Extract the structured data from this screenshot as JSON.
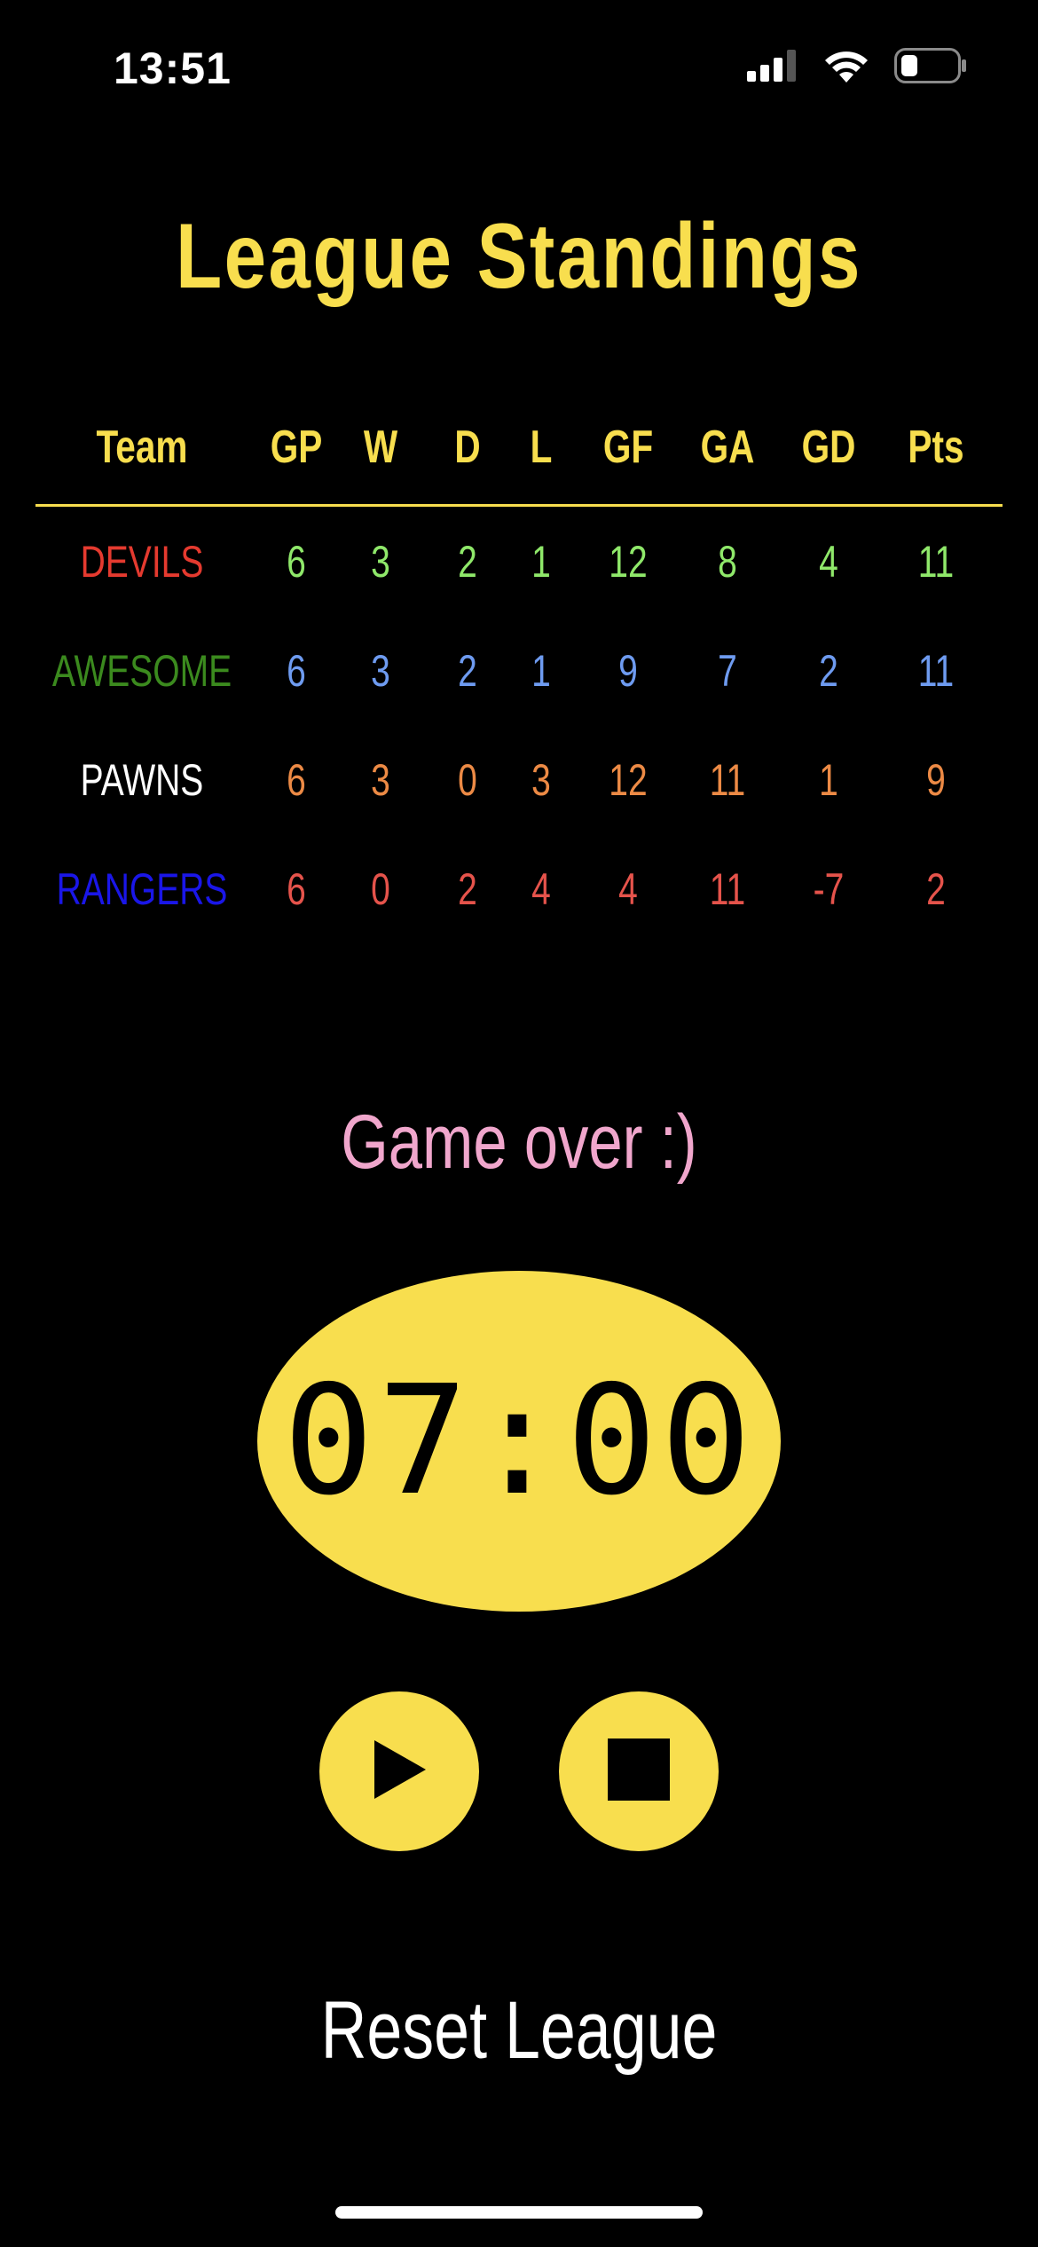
{
  "status_bar": {
    "time": "13:51",
    "icons": [
      "cellular-signal-icon",
      "wifi-icon",
      "battery-icon"
    ]
  },
  "title": "League Standings",
  "standings": {
    "headers": [
      "Team",
      "GP",
      "W",
      "D",
      "L",
      "GF",
      "GA",
      "GD",
      "Pts"
    ],
    "header_color": "#f8de4e",
    "rows": [
      {
        "team": "DEVILS",
        "team_color": "#e53a2f",
        "stat_color": "#8fe86a",
        "gp": "6",
        "w": "3",
        "d": "2",
        "l": "1",
        "gf": "12",
        "ga": "8",
        "gd": "4",
        "pts": "11"
      },
      {
        "team": "AWESOME",
        "team_color": "#3b8a1e",
        "stat_color": "#6e9bf0",
        "gp": "6",
        "w": "3",
        "d": "2",
        "l": "1",
        "gf": "9",
        "ga": "7",
        "gd": "2",
        "pts": "11"
      },
      {
        "team": "PAWNS",
        "team_color": "#ffffff",
        "stat_color": "#ec8a45",
        "gp": "6",
        "w": "3",
        "d": "0",
        "l": "3",
        "gf": "12",
        "ga": "11",
        "gd": "1",
        "pts": "9"
      },
      {
        "team": "RANGERS",
        "team_color": "#1a16e8",
        "stat_color": "#e5534b",
        "gp": "6",
        "w": "0",
        "d": "2",
        "l": "4",
        "gf": "4",
        "ga": "11",
        "gd": "-7",
        "pts": "2"
      }
    ]
  },
  "game_status": "Game over :)",
  "timer": "07:00",
  "controls": {
    "play_icon": "play-icon",
    "stop_icon": "stop-icon"
  },
  "reset_label": "Reset League",
  "colors": {
    "accent": "#f8de4e",
    "game_status": "#f0a6cc",
    "background": "#000000"
  }
}
